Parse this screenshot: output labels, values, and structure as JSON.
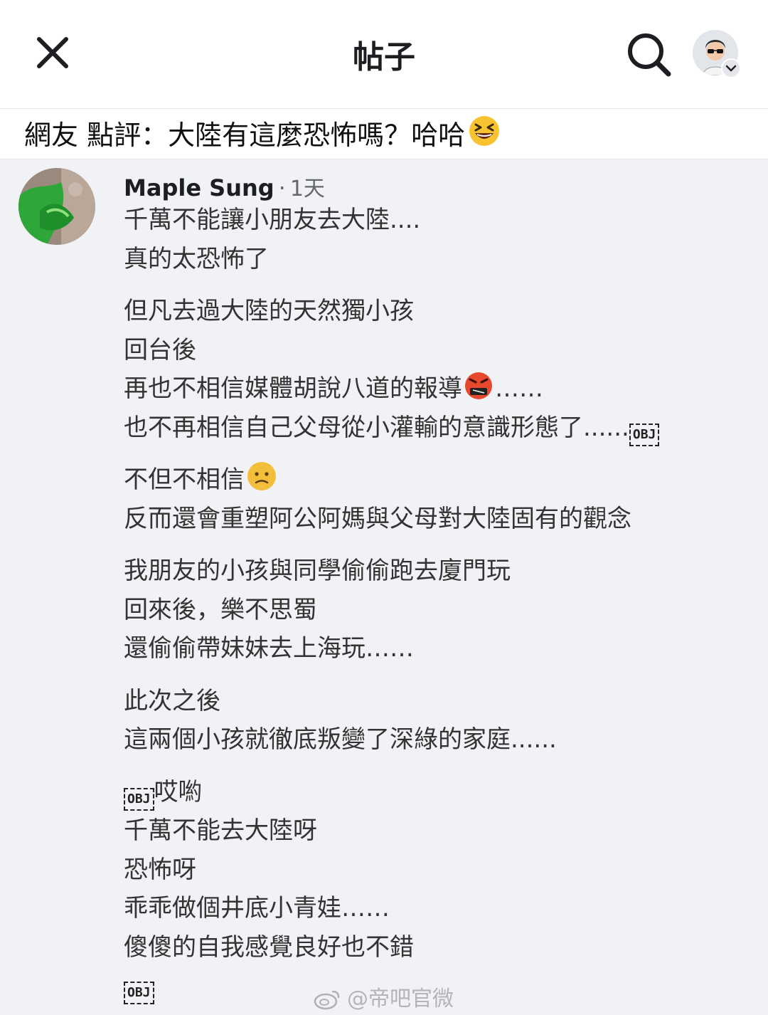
{
  "header": {
    "title": "帖子",
    "close_icon": "close-icon",
    "search_icon": "search-icon",
    "profile_icon": "avatar"
  },
  "banner": {
    "text": "網友 點評：大陸有這麼恐怖嗎？哈哈",
    "emoji": "laughing-face-emoji"
  },
  "comment": {
    "author": "Maple Sung",
    "separator": "·",
    "time": "1天",
    "paragraphs": [
      [
        "千萬不能讓小朋友去大陸....",
        "真的太恐怖了"
      ],
      [
        "但凡去過大陸的天然獨小孩",
        "回台後",
        "再也不相信媒體胡說八道的報導",
        "也不再相信自己父母從小灌輸的意識形態了......"
      ],
      [
        "不但不相信",
        "反而還會重塑阿公阿媽與父母對大陸固有的觀念"
      ],
      [
        "我朋友的小孩與同學偷偷跑去廈門玩",
        "回來後，樂不思蜀",
        "還偷偷帶妹妹去上海玩……"
      ],
      [
        "此次之後",
        "這兩個小孩就徹底叛變了深綠的家庭......"
      ],
      [
        "哎喲",
        "千萬不能去大陸呀",
        "恐怖呀",
        "乖乖做個井底小青娃……",
        "傻傻的自我感覺良好也不錯"
      ]
    ],
    "inline": {
      "ellipsis_after_emoji": "……",
      "obj_placeholder": "OBJ"
    }
  },
  "watermark": "@帝吧官微",
  "colors": {
    "surface": "#ffffff",
    "background": "#f0f2f5",
    "text": "#1c1e21",
    "muted": "#65676b"
  }
}
